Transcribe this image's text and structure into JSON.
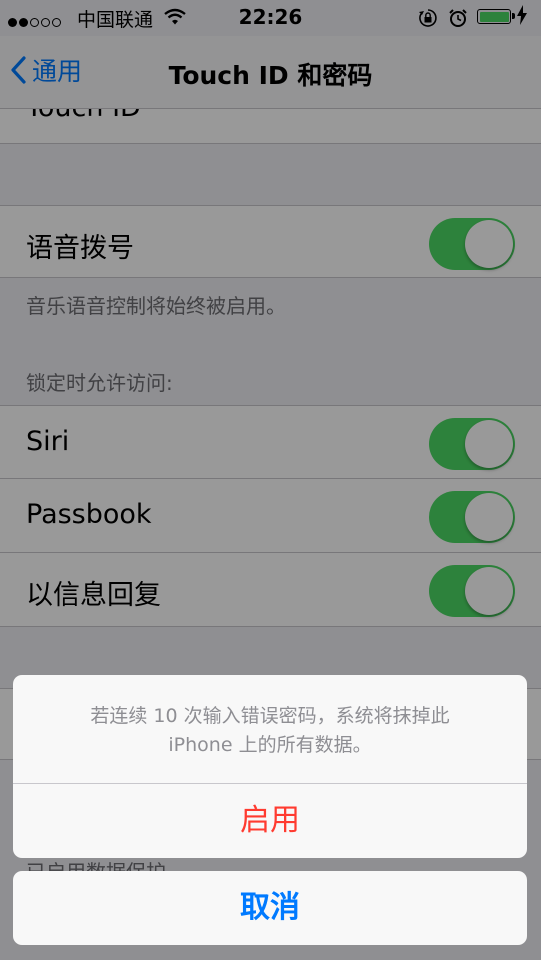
{
  "status_bar": {
    "signal_dots": [
      "on",
      "on",
      "off",
      "off",
      "off"
    ],
    "carrier": "中国联通",
    "time": "22:26",
    "battery_level": 1.0,
    "battery_color": "#4cd964"
  },
  "nav": {
    "back_label": "通用",
    "title": "Touch ID 和密码"
  },
  "settings": {
    "partial_row": "Touch ID",
    "voice_dial": {
      "label": "语音拨号",
      "on": true
    },
    "voice_dial_footer": "音乐语音控制将始终被启用。",
    "lock_access_header": "锁定时允许访问:",
    "siri": {
      "label": "Siri",
      "on": true
    },
    "passbook": {
      "label": "Passbook",
      "on": true
    },
    "reply_message": {
      "label": "以信息回复",
      "on": true
    },
    "data_protection_footer": "已启用数据保护"
  },
  "action_sheet": {
    "message_line1": "若连续 10 次输入错误密码，系统将抹掉此",
    "message_line2": "iPhone 上的所有数据。",
    "enable_label": "启用",
    "cancel_label": "取消"
  },
  "colors": {
    "accent": "#007aff",
    "destructive": "#ff3b30",
    "toggle_on": "#4cd964"
  }
}
